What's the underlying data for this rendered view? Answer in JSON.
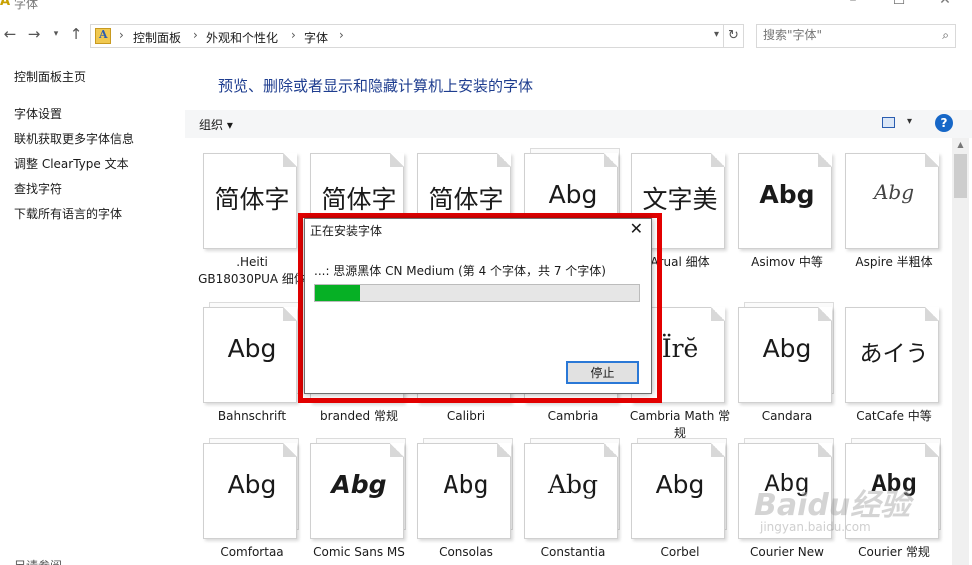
{
  "window": {
    "title": "字体"
  },
  "address_bar": {
    "breadcrumbs": [
      "控制面板",
      "外观和个性化",
      "字体"
    ],
    "search_placeholder": "搜索\"字体\""
  },
  "sidebar": {
    "items": [
      {
        "label": "控制面板主页"
      },
      {
        "label": "字体设置"
      },
      {
        "label": "联机获取更多字体信息"
      },
      {
        "label": "调整 ClearType 文本"
      },
      {
        "label": "查找字符"
      },
      {
        "label": "下载所有语言的字体"
      },
      {
        "label": "另请参阅"
      }
    ]
  },
  "main": {
    "heading": "预览、删除或者显示和隐藏计算机上安装的字体",
    "toolbar": {
      "organize": "组织 ▾",
      "help": "?"
    },
    "fonts": [
      {
        "sample": "简体字",
        "label": ".Heiti GB18030PUA 细体"
      },
      {
        "sample": "简体字",
        "label": ""
      },
      {
        "sample": "简体字",
        "label": ""
      },
      {
        "sample": "Abg",
        "label": ""
      },
      {
        "sample": "文字美",
        "label": "Arual 细体"
      },
      {
        "sample": "Abg",
        "label": "Asimov 中等"
      },
      {
        "sample": "Abg",
        "label": "Aspire 半粗体"
      },
      {
        "sample": "Abg",
        "label": "Bahnschrift"
      },
      {
        "sample": "",
        "label": "branded 常规"
      },
      {
        "sample": "",
        "label": "Calibri"
      },
      {
        "sample": "",
        "label": "Cambria"
      },
      {
        "sample": "Ïrĕ",
        "label": "Cambria Math 常规"
      },
      {
        "sample": "Abg",
        "label": "Candara"
      },
      {
        "sample": "あイう",
        "label": "CatCafe 中等"
      },
      {
        "sample": "Abg",
        "label": "Comfortaa"
      },
      {
        "sample": "Abg",
        "label": "Comic Sans MS"
      },
      {
        "sample": "Abg",
        "label": "Consolas"
      },
      {
        "sample": "Abg",
        "label": "Constantia"
      },
      {
        "sample": "Abg",
        "label": "Corbel"
      },
      {
        "sample": "Abg",
        "label": "Courier New"
      },
      {
        "sample": "Abg",
        "label": "Courier 常规"
      }
    ]
  },
  "dialog": {
    "title": "正在安装字体",
    "status": "...: 思源黑体 CN Medium (第 4 个字体，共 7 个字体)",
    "progress_fraction": 0.14,
    "stop_label": "停止",
    "highlight_color": "#e30000"
  },
  "watermark": {
    "logo": "Baidu经验",
    "url": "jingyan.baidu.com"
  },
  "colors": {
    "accent": "#1e3d8f",
    "progress": "#06b025"
  }
}
